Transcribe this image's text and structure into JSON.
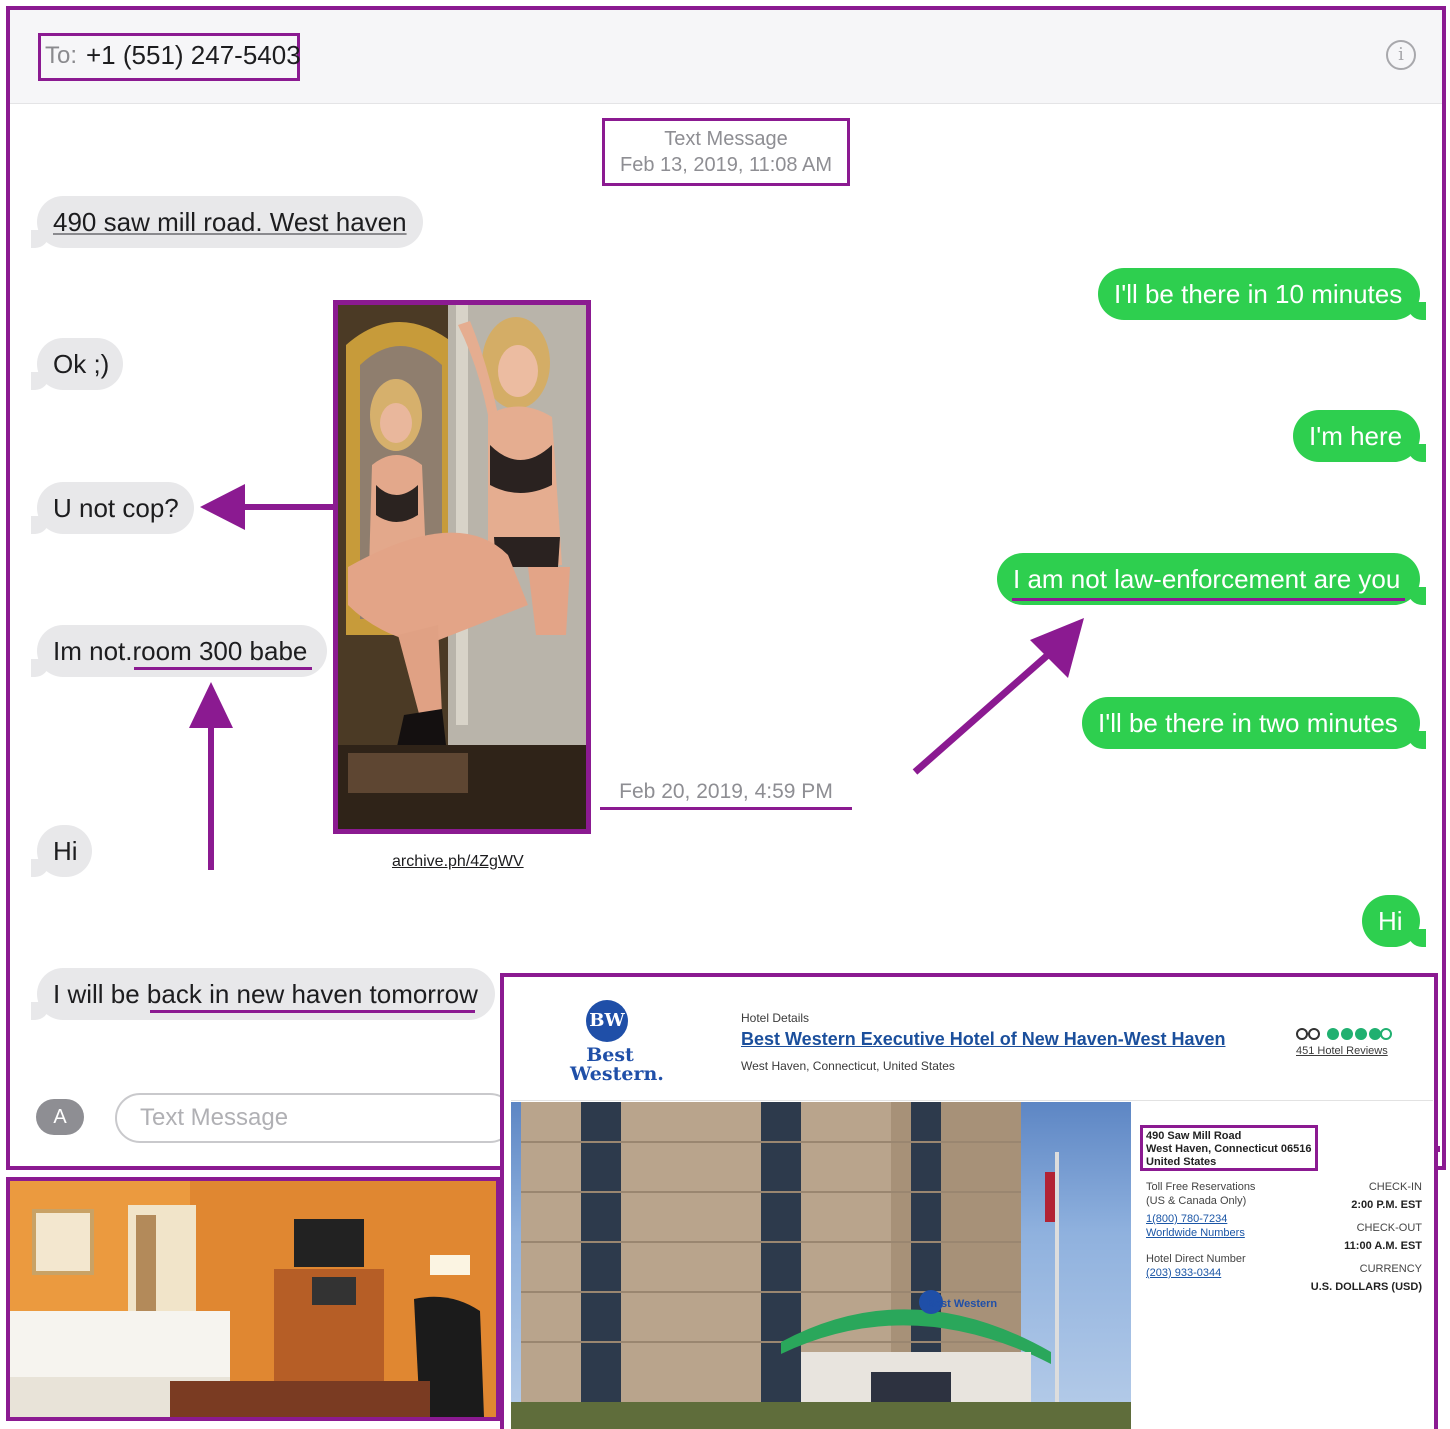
{
  "header": {
    "to_label": "To:",
    "to_number": "+1 (551) 247-5403",
    "info_icon": "info-icon"
  },
  "timestamps": {
    "first_kind": "Text Message",
    "first_date": "Feb 13, 2019, 11:08 AM",
    "second": "Feb 20, 2019, 4:59 PM"
  },
  "messages": {
    "in_1": "490 saw mill road. West haven",
    "out_1": "I'll be there in 10 minutes",
    "in_2": "Ok ;)",
    "out_2": "I'm here",
    "in_3": "U not cop?",
    "out_3": "I am not law-enforcement are you",
    "in_4_pre": "Im not.",
    "in_4_post": "room 300 babe",
    "out_4": "I'll be there in two minutes",
    "in_5": "Hi",
    "out_5": "Hi",
    "in_6_pre": "I will be ",
    "in_6_post": "back in new haven tomorrow"
  },
  "photo": {
    "caption": "archive.ph/4ZgWV"
  },
  "compose": {
    "placeholder": "Text Message",
    "app_icon": "app-store-icon"
  },
  "hotel": {
    "logo_monogram": "BW",
    "logo_line1": "Best",
    "logo_line2": "Western.",
    "section": "Hotel Details",
    "name": "Best Western Executive Hotel of New Haven-West Haven",
    "location": "West Haven, Connecticut, United States",
    "rating": 4.5,
    "reviews": "451 Hotel Reviews",
    "address_1": "490 Saw Mill Road",
    "address_2": "West Haven, Connecticut 06516",
    "address_3": "United States",
    "toll_free_label": "Toll Free Reservations",
    "toll_free_note": "(US & Canada Only)",
    "toll_free_number": "1(800) 780-7234",
    "worldwide": "Worldwide Numbers",
    "direct_label": "Hotel Direct Number",
    "direct_number": "(203) 933-0344",
    "checkin_label": "CHECK-IN",
    "checkin_value": "2:00 P.M. EST",
    "checkout_label": "CHECK-OUT",
    "checkout_value": "11:00 A.M. EST",
    "currency_label": "CURRENCY",
    "currency_value": "U.S. DOLLARS (USD)",
    "sign_text": "Best Western"
  },
  "colors": {
    "annotation": "#8b1a91",
    "outgoing": "#2ecf4f",
    "incoming": "#e8e8ea",
    "link": "#1b56a6"
  }
}
